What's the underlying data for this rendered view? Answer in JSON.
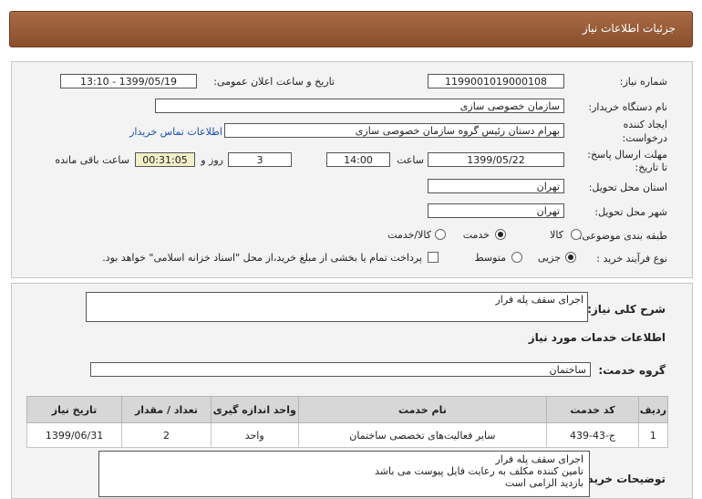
{
  "header": {
    "title": "جزئیات اطلاعات نیاز"
  },
  "info": {
    "need_number_label": "شماره نیاز:",
    "need_number": "1199001019000108",
    "announce_label": "تاریخ و ساعت اعلان عمومی:",
    "announce_value": "1399/05/19 - 13:10",
    "buyer_org_label": "نام دستگاه خریدار:",
    "buyer_org": "سازمان خصوصی سازی",
    "creator_label_1": "ایجاد کننده",
    "creator_label_2": "درخواست:",
    "creator": "بهرام دستان رئیس گروه سازمان خصوصی سازی",
    "contact_link": "اطلاعات تماس خریدار",
    "deadline_label_1": "مهلت ارسال پاسخ:",
    "deadline_label_2": "تا تاریخ:",
    "deadline_date": "1399/05/22",
    "time_label": "ساعت",
    "deadline_time": "14:00",
    "days_value": "3",
    "days_label": "روز و",
    "remaining_time": "00:31:05",
    "remaining_label": "ساعت باقی مانده",
    "province_label": "استان محل تحویل:",
    "province": "تهران",
    "city_label": "شهر محل تحویل:",
    "city": "تهران",
    "category_label": "طبقه بندی موضوعی:",
    "category_options": [
      "کالا",
      "خدمت",
      "کالا/خدمت"
    ],
    "process_label": "نوع فرآیند خرید :",
    "process_options": [
      "جزیی",
      "متوسط"
    ],
    "payment_note": "پرداخت تمام یا بخشی از مبلغ خرید،از محل \"اسناد خزانه اسلامی\" خواهد بود."
  },
  "details": {
    "summary_label": "شرح کلی نیاز:",
    "summary": "اجرای سقف پله فرار",
    "services_title": "اطلاعات خدمات مورد نیاز",
    "service_group_label": "گروه خدمت:",
    "service_group": "ساختمان",
    "table": {
      "headers": [
        "ردیف",
        "کد خدمت",
        "نام خدمت",
        "واحد اندازه گیری",
        "تعداد / مقدار",
        "تاریخ نیاز"
      ],
      "rows": [
        [
          "1",
          "ج-43-439",
          "سایر فعالیت‌های تخصصی ساختمان",
          "واحد",
          "2",
          "1399/06/31"
        ]
      ]
    },
    "buyer_notes_label": "توضیحات خریدار:",
    "buyer_notes": [
      "اجرای سقف پله فرار",
      "تامین کننده مکلف به رعایت فایل پیوست می باشد",
      "بازدید الزامی است"
    ]
  }
}
